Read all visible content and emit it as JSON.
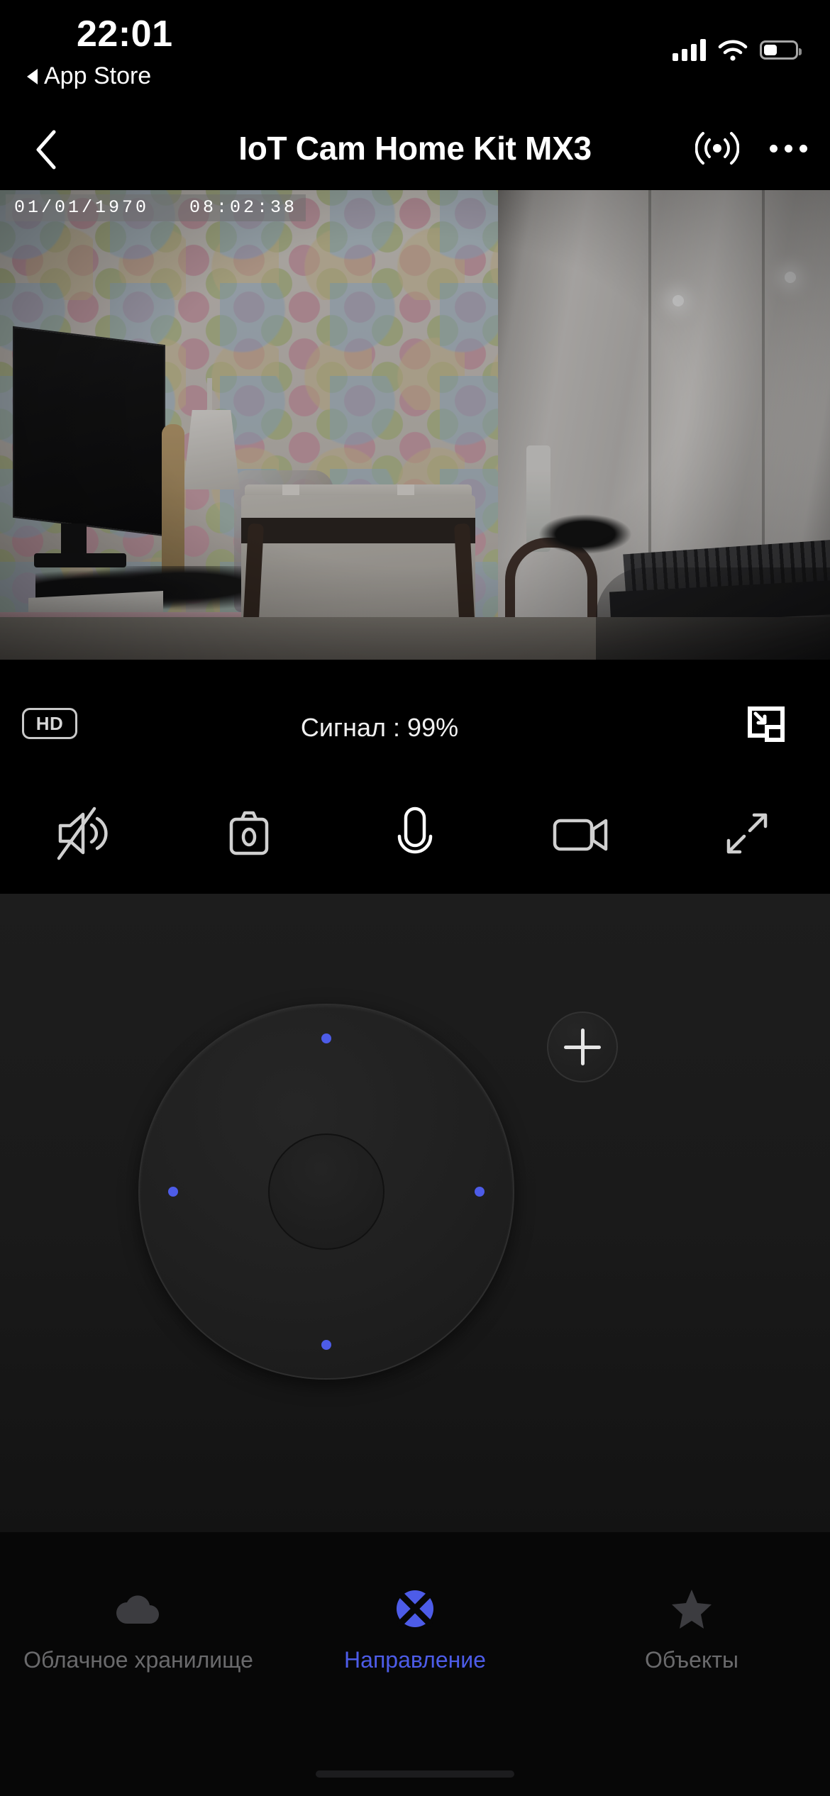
{
  "status_bar": {
    "time": "22:01",
    "return_app_label": "App Store",
    "cellular_icon": "signal-bars-icon",
    "wifi_icon": "wifi-icon",
    "battery_icon": "battery-icon",
    "battery_level_percent": 38
  },
  "nav": {
    "back_icon": "chevron-left-icon",
    "title": "IoT Cam Home Kit MX3",
    "broadcast_icon": "broadcast-signal-icon",
    "more_icon": "more-horizontal-icon"
  },
  "video": {
    "overlay_date": "01/01/1970",
    "overlay_time": "08:02:38",
    "overlay_text": "01/01/1970   08:02:38",
    "scene_description": "Room with polka-dot wallpaper, desk with monitor, chairs and white wardrobe"
  },
  "info_bar": {
    "quality_badge": "HD",
    "signal_label": "Сигнал : 99%",
    "pip_icon": "picture-in-picture-icon"
  },
  "controls": [
    {
      "name": "mute-button",
      "icon": "speaker-muted-icon"
    },
    {
      "name": "snapshot-button",
      "icon": "camera-icon"
    },
    {
      "name": "talk-button",
      "icon": "microphone-icon"
    },
    {
      "name": "record-button",
      "icon": "video-camera-icon"
    },
    {
      "name": "fullscreen-button",
      "icon": "expand-arrows-icon"
    }
  ],
  "ptz": {
    "dpad_name": "direction-pad",
    "dpad_directions": [
      "up",
      "left",
      "right",
      "down"
    ],
    "add_preset_icon": "plus-icon"
  },
  "tabs": [
    {
      "label": "Облачное хранилище",
      "icon": "cloud-icon",
      "active": false
    },
    {
      "label": "Направление",
      "icon": "direction-pad-icon",
      "active": true
    },
    {
      "label": "Объекты",
      "icon": "star-icon",
      "active": false
    }
  ],
  "colors": {
    "accent": "#4d5ce8",
    "background": "#000000",
    "panel": "#1b1b1b",
    "tabbar": "#070707",
    "inactive_text": "#6a6a6c",
    "icon": "#d4d4d4"
  }
}
